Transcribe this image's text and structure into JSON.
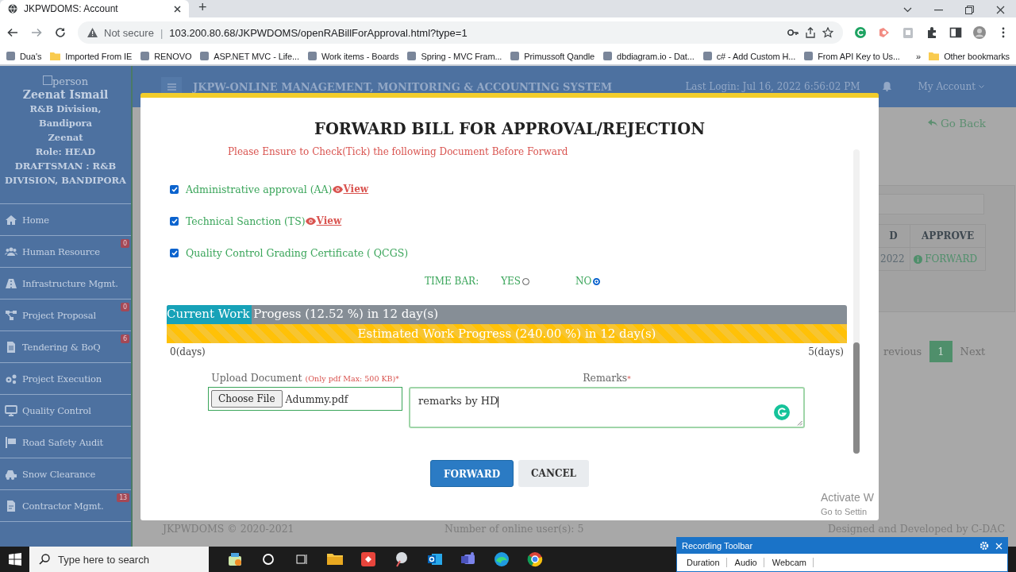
{
  "browser": {
    "tab_title": "JKPWDOMS: Account",
    "new_tab": "+",
    "not_secure": "Not secure",
    "separator": "|",
    "url": "103.200.80.68/JKPWDOMS/openRABillForApproval.html?type=1",
    "bookmarks": [
      {
        "label": "Dua's",
        "kind": "site"
      },
      {
        "label": "Imported From IE",
        "kind": "folder"
      },
      {
        "label": "RENOVO",
        "kind": "site"
      },
      {
        "label": "ASP.NET MVC - Life...",
        "kind": "site"
      },
      {
        "label": "Work items - Boards",
        "kind": "site"
      },
      {
        "label": "Spring - MVC Fram...",
        "kind": "site"
      },
      {
        "label": "Primussoft Qandle",
        "kind": "site"
      },
      {
        "label": "dbdiagram.io - Dat...",
        "kind": "site"
      },
      {
        "label": "c# - Add Custom H...",
        "kind": "site"
      },
      {
        "label": "From API Key to Us...",
        "kind": "site"
      }
    ],
    "more": "»",
    "other_bookmarks": "Other bookmarks"
  },
  "sidebar": {
    "avatar_alt": "person",
    "user_name": "Zeenat  Ismail",
    "division": "R&B Division, Bandipora",
    "short_name": "Zeenat",
    "role": "Role: HEAD DRAFTSMAN : R&B DIVISION, BANDIPORA",
    "items": [
      {
        "label": "Home"
      },
      {
        "label": "Human Resource",
        "badge": "0"
      },
      {
        "label": "Infrastructure Mgmt."
      },
      {
        "label": "Project Proposal",
        "badge": "0"
      },
      {
        "label": "Tendering & BoQ",
        "badge": "6"
      },
      {
        "label": "Project Execution"
      },
      {
        "label": "Quality Control"
      },
      {
        "label": "Road Safety Audit"
      },
      {
        "label": "Snow Clearance"
      },
      {
        "label": "Contractor Mgmt.",
        "badge": "13"
      }
    ]
  },
  "header": {
    "title": "JKPW-ONLINE MANAGEMENT, MONITORING & ACCOUNTING SYSTEM",
    "last_login": "Last Login: Jul 16, 2022 6:56:02 PM",
    "account": "My Account"
  },
  "page": {
    "go_back": "Go Back",
    "table": {
      "columns": [
        "D",
        "APPROVE"
      ],
      "rows": [
        [
          "2022",
          "FORWARD"
        ]
      ]
    },
    "pagination": [
      {
        "label": "revious",
        "selected": false
      },
      {
        "label": "1",
        "selected": true
      },
      {
        "label": "Next",
        "selected": false
      }
    ]
  },
  "modal": {
    "title": "FORWARD BILL FOR APPROVAL/REJECTION",
    "notice": "Please Ensure to Check(Tick) the following Document Before Forward",
    "documents": [
      {
        "label": "Administrative approval (AA)",
        "checked": true,
        "link": "View"
      },
      {
        "label": "Technical Sanction (TS)",
        "checked": true,
        "link": "View"
      },
      {
        "label": "Quality Control Grading Certificate ( QCGS)",
        "checked": true
      }
    ],
    "time_bar": {
      "label": "TIME BAR:",
      "options": [
        {
          "label": "YES",
          "selected": false
        },
        {
          "label": "NO",
          "selected": true
        }
      ]
    },
    "current_progress": {
      "text": "Current Work Progess (12.52 %) in 12 day(s)",
      "level": 0.1252
    },
    "estimated_progress": {
      "text": "Estimated Work Progress (240.00 %) in 12 day(s)",
      "level": 1
    },
    "scale_start": "0(days)",
    "scale_end": "5(days)",
    "upload": {
      "label": "Upload Document",
      "hint": "(Only pdf Max: 500 KB)",
      "required": "*",
      "button": "Choose File",
      "file": "Adummy.pdf"
    },
    "remarks": {
      "label": "Remarks",
      "required": "*",
      "value": "remarks by HD"
    },
    "buttons": [
      {
        "label": "FORWARD",
        "kind": "primary"
      },
      {
        "label": "CANCEL",
        "kind": "secondary"
      }
    ]
  },
  "footer": {
    "copyright": "JKPWDOMS © 2020-2021",
    "online_users": "Number of online user(s): 5",
    "credit": "Designed and Developed by C-DAC"
  },
  "activation": {
    "line_1": "Activate W",
    "line_2": "Go to Settin"
  },
  "taskbar": {
    "search_placeholder": "Type here to search"
  },
  "recording_toolbar": {
    "title": "Recording Toolbar",
    "tabs": [
      "Duration",
      "Audio",
      "Webcam"
    ]
  }
}
